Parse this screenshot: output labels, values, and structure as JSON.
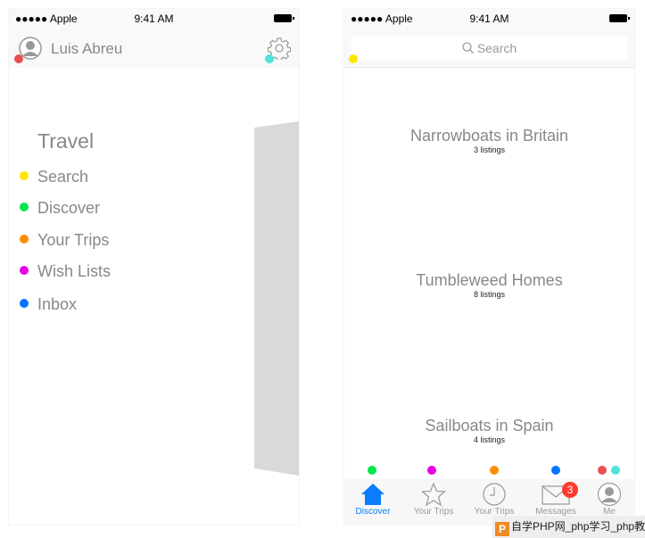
{
  "status_bar": {
    "carrier": "●●●●● Apple",
    "time": "9:41 AM"
  },
  "left_screen": {
    "user_name": "Luis Abreu",
    "menu_title": "Travel",
    "menu_items": [
      {
        "label": "Search",
        "color": "#ffe600"
      },
      {
        "label": "Discover",
        "color": "#00e64d"
      },
      {
        "label": "Your Trips",
        "color": "#ff8c00"
      },
      {
        "label": "Wish Lists",
        "color": "#e600e6"
      },
      {
        "label": "Inbox",
        "color": "#0073ff"
      }
    ],
    "avatar_dot_color": "#e85050",
    "gear_dot_color": "#50e3d8"
  },
  "right_screen": {
    "search_placeholder": "Search",
    "search_dot_color": "#ffe600",
    "categories": [
      {
        "title": "Narrowboats in Britain",
        "count": "3 listings"
      },
      {
        "title": "Tumbleweed Homes",
        "count": "8 listings"
      },
      {
        "title": "Sailboats in Spain",
        "count": "4 listings"
      }
    ],
    "tabs": [
      {
        "label": "Discover",
        "icon": "home-icon",
        "active": true,
        "dot": "#00e64d"
      },
      {
        "label": "Your Trips",
        "icon": "star-icon",
        "dot": "#e600e6"
      },
      {
        "label": "Your Trips",
        "icon": "clock-icon",
        "dot": "#ff8c00"
      },
      {
        "label": "Messages",
        "icon": "mail-icon",
        "badge": "3",
        "dot": "#0073ff"
      },
      {
        "label": "Me",
        "icon": "user-icon",
        "dot": "#e85050",
        "dot2": "#50e3d8"
      }
    ],
    "accent": "#0a7cff"
  },
  "watermark": "自学PHP网_php学习_php教"
}
